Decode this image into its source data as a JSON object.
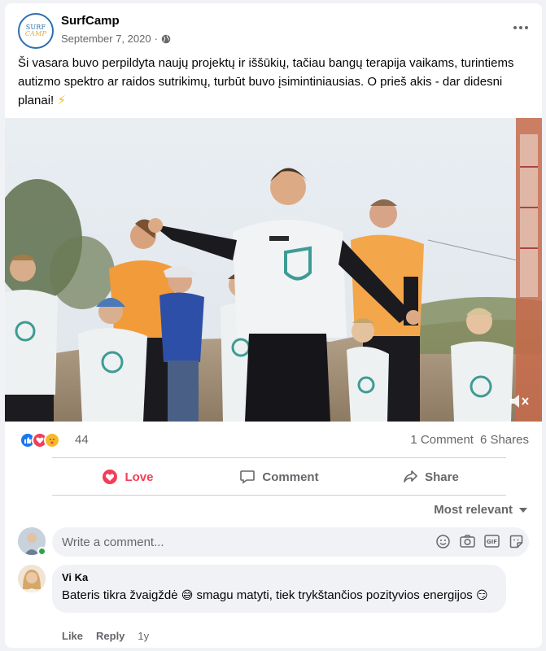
{
  "post": {
    "page_name": "SurfCamp",
    "logo_text_top": "SURF",
    "logo_text_bottom": "CAMP",
    "date": "September 7, 2020",
    "separator": "·",
    "text": "Ši vasara buvo perpildyta naujų projektų ir iššūkių, tačiau bangų terapija vaikams, turintiems autizmo spektro ar raidos sutrikimų, turbūt buvo įsimintiniausias. O prieš akis - dar didesni planai! ",
    "text_emoji": "⚡"
  },
  "reactions": {
    "icons": [
      "like-icon",
      "love-icon",
      "care-icon"
    ],
    "count": "44",
    "comments": "1 Comment",
    "shares": "6 Shares"
  },
  "actions": {
    "love_label": "Love",
    "comment_label": "Comment",
    "share_label": "Share"
  },
  "comments_section": {
    "sort_label": "Most relevant",
    "input_placeholder": "Write a comment...",
    "tools": [
      "emoji-icon",
      "camera-icon",
      "gif-icon",
      "sticker-icon"
    ]
  },
  "comment": {
    "author": "Vi Ka",
    "text_part1": "Bateris tikra žvaigždė ",
    "emoji1": "😅",
    "text_part2": " smagu matyti, tiek trykštančios pozityvios energijos ",
    "emoji2": "😏",
    "like_label": "Like",
    "reply_label": "Reply",
    "time": "1y"
  },
  "colors": {
    "accent": "#1877f2",
    "love": "#f33e58",
    "secondary_text": "#65676b",
    "rashguard_logo": "#3e9b95",
    "orange_shirt": "#f29b3a"
  }
}
